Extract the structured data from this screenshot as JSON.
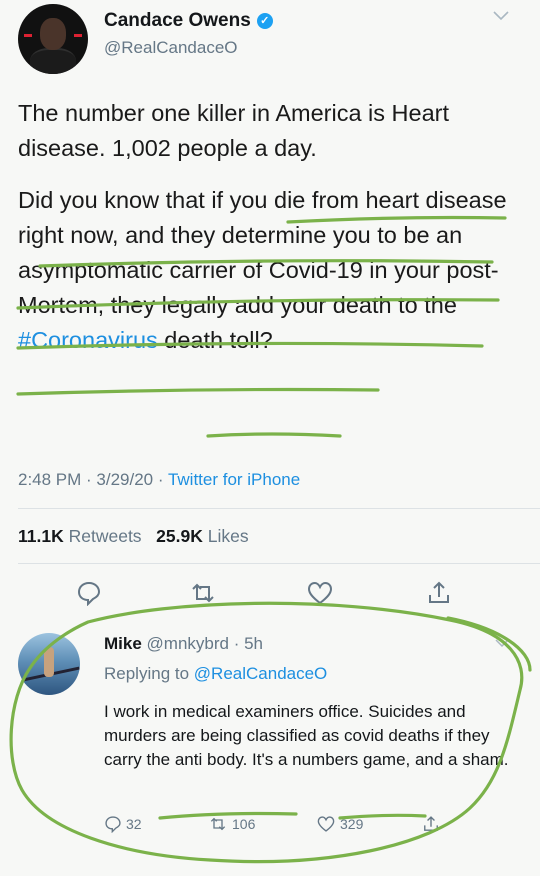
{
  "tweet": {
    "name": "Candace Owens",
    "handle": "@RealCandaceO",
    "paragraph1": "The number one killer in America is Heart disease. 1,002 people a day.",
    "paragraph2_part1": "Did you know that if you die from heart disease right now, and they determine you to be an asymptomatic carrier of Covid-19 in your post-Mortem, they legally add your death to the",
    "hashtag": "#Coronavirus",
    "paragraph2_part2": "death toll?",
    "time": "2:48 PM · 3/29/20 · ",
    "source": "Twitter for iPhone",
    "retweets_count": "11.1K",
    "retweets_label": "Retweets",
    "likes_count": "25.9K",
    "likes_label": "Likes"
  },
  "reply": {
    "name": "Mike",
    "handle_time": "@mnkybrd · 5h",
    "replying_label": "Replying to ",
    "replying_to": "@RealCandaceO",
    "text": "I work in medical examiners office. Suicides and murders are being classified as covid deaths if they carry the anti body. It's a numbers game, and a sham.",
    "reply_count": "32",
    "retweet_count": "106",
    "like_count": "329"
  },
  "icons": {
    "verified": "verified-badge-icon",
    "caret": "chevron-down-icon",
    "reply": "reply-bubble-icon",
    "retweet": "retweet-icon",
    "like": "heart-icon",
    "share": "share-icon"
  },
  "colors": {
    "link": "#1d8fe0",
    "verified": "#1da1f2",
    "muted": "#657786",
    "marker": "#7bb24a"
  }
}
